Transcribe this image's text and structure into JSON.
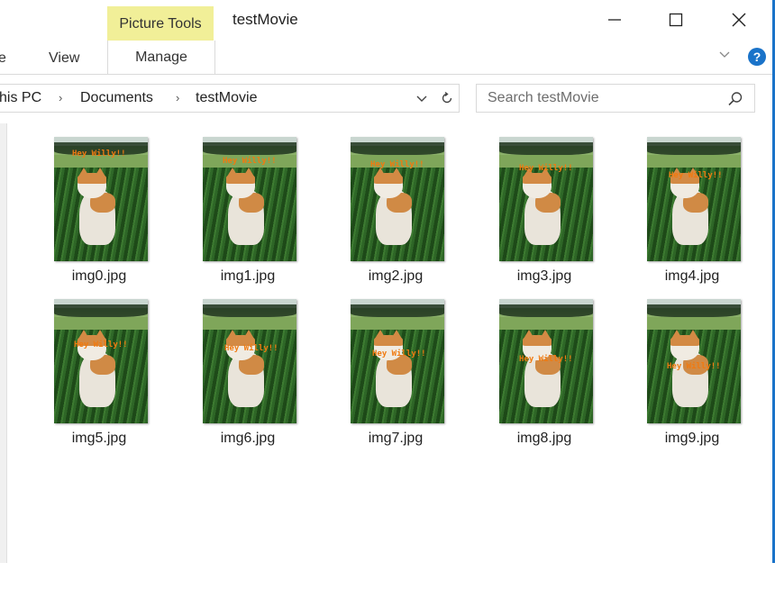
{
  "window": {
    "title": "testMovie",
    "context_tab": "Picture Tools",
    "accent": "#1a73c9",
    "context_color": "#f1ef98"
  },
  "ribbon": {
    "tabs": [
      {
        "label": "e"
      },
      {
        "label": "View"
      },
      {
        "label": "Manage"
      }
    ],
    "help": "?"
  },
  "address": {
    "crumbs": [
      "his PC",
      "Documents",
      "testMovie"
    ]
  },
  "search": {
    "placeholder": "Search testMovie"
  },
  "files": [
    {
      "name": "img0.jpg",
      "caption": "Hey Willy!!"
    },
    {
      "name": "img1.jpg",
      "caption": "Hey Willy!!"
    },
    {
      "name": "img2.jpg",
      "caption": "Hey Willy!!"
    },
    {
      "name": "img3.jpg",
      "caption": "Hey Willy!!"
    },
    {
      "name": "img4.jpg",
      "caption": "Hey Willy!!"
    },
    {
      "name": "img5.jpg",
      "caption": "Hey Willy!!"
    },
    {
      "name": "img6.jpg",
      "caption": "Hey Willy!!"
    },
    {
      "name": "img7.jpg",
      "caption": "Hey Willy!!"
    },
    {
      "name": "img8.jpg",
      "caption": "Hey Willy!!"
    },
    {
      "name": "img9.jpg",
      "caption": "Hey Willy!!"
    }
  ]
}
